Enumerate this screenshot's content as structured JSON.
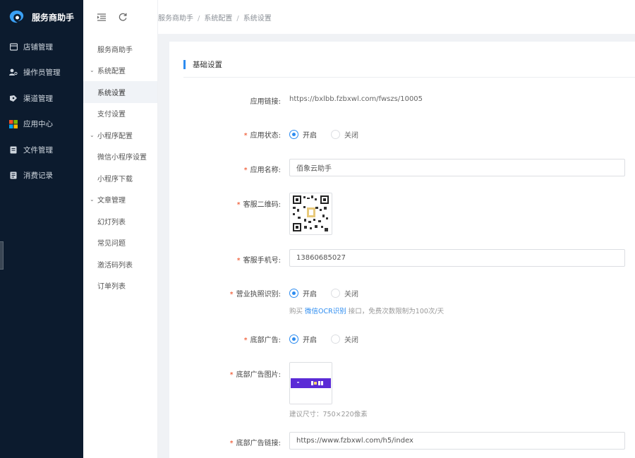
{
  "app": {
    "title": "服务商助手"
  },
  "sidebar": {
    "items": [
      {
        "label": "店铺管理",
        "icon": "store-icon"
      },
      {
        "label": "操作员管理",
        "icon": "user-key-icon"
      },
      {
        "label": "渠道管理",
        "icon": "channel-icon"
      },
      {
        "label": "应用中心",
        "icon": "app-grid-icon"
      },
      {
        "label": "文件管理",
        "icon": "file-icon"
      },
      {
        "label": "消费记录",
        "icon": "record-icon"
      }
    ]
  },
  "submenu": {
    "home": "服务商助手",
    "groups": [
      {
        "label": "系统配置",
        "items": [
          "系统设置",
          "支付设置"
        ]
      },
      {
        "label": "小程序配置",
        "items": [
          "微信小程序设置",
          "小程序下载"
        ]
      },
      {
        "label": "文章管理",
        "items": [
          "幻灯列表",
          "常见问题",
          "激活码列表",
          "订单列表"
        ]
      }
    ],
    "active": "系统设置"
  },
  "breadcrumb": [
    "服务商助手",
    "系统配置",
    "系统设置"
  ],
  "section_title": "基础设置",
  "form": {
    "app_link": {
      "label": "应用链接:",
      "value": "https://bxlbb.fzbxwl.com/fwszs/10005"
    },
    "app_status": {
      "label": "应用状态:",
      "on": "开启",
      "off": "关闭",
      "selected": "开启"
    },
    "app_name": {
      "label": "应用名称:",
      "value": "佰象云助手"
    },
    "qrcode": {
      "label": "客服二维码:"
    },
    "phone": {
      "label": "客服手机号:",
      "value": "13860685027"
    },
    "license": {
      "label": "营业执照识别:",
      "on": "开启",
      "off": "关闭",
      "selected": "开启",
      "hint_prefix": "购买 ",
      "hint_link": "微信OCR识别",
      "hint_suffix": " 接口，免费次数限制为100次/天"
    },
    "bottom_ad": {
      "label": "底部广告:",
      "on": "开启",
      "off": "关闭",
      "selected": "开启"
    },
    "bottom_ad_image": {
      "label": "底部广告图片:",
      "hint": "建议尺寸：750×220像素"
    },
    "bottom_ad_link": {
      "label": "底部广告链接:",
      "value": "https://www.fzbxwl.com/h5/index"
    }
  },
  "colors": {
    "sidebar_bg": "#0c1b2e",
    "primary": "#2d8cf0",
    "required": "#ed4014"
  }
}
